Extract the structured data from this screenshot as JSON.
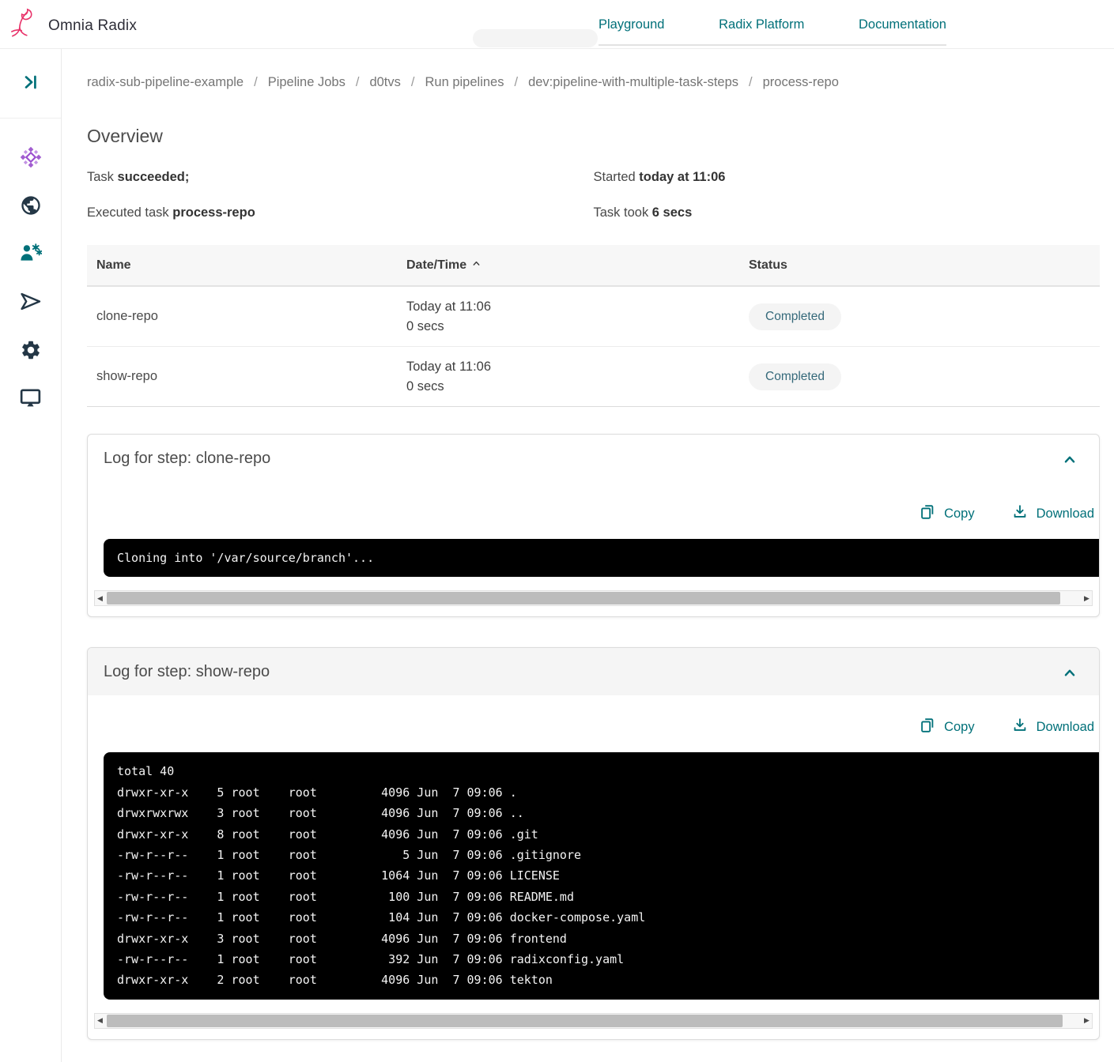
{
  "header": {
    "brand": "Omnia Radix",
    "nav": [
      {
        "label": "Playground"
      },
      {
        "label": "Radix Platform"
      },
      {
        "label": "Documentation"
      }
    ]
  },
  "sidebar": {
    "icons": [
      {
        "name": "app-mosaic-icon"
      },
      {
        "name": "globe-icon"
      },
      {
        "name": "user-settings-icon"
      },
      {
        "name": "send-icon"
      },
      {
        "name": "gear-icon"
      },
      {
        "name": "monitor-icon"
      }
    ]
  },
  "breadcrumb": {
    "separator": "/",
    "items": [
      "radix-sub-pipeline-example",
      "Pipeline Jobs",
      "d0tvs",
      "Run pipelines",
      "dev:pipeline-with-multiple-task-steps",
      "process-repo"
    ]
  },
  "overview": {
    "title": "Overview",
    "task_label": "Task",
    "task_status": "succeeded;",
    "executed_label": "Executed task",
    "executed_value": "process-repo",
    "started_label": "Started",
    "started_value": "today at 11:06",
    "duration_label": "Task took",
    "duration_value": "6 secs"
  },
  "steps_table": {
    "headers": {
      "name": "Name",
      "datetime": "Date/Time",
      "status": "Status"
    },
    "rows": [
      {
        "name": "clone-repo",
        "date": "Today at 11:06",
        "duration": "0 secs",
        "status": "Completed"
      },
      {
        "name": "show-repo",
        "date": "Today at 11:06",
        "duration": "0 secs",
        "status": "Completed"
      }
    ]
  },
  "logs": [
    {
      "title": "Log for step: clone-repo",
      "copy_label": "Copy",
      "download_label": "Download",
      "terminal_lines": [
        "Cloning into '/var/source/branch'..."
      ]
    },
    {
      "title": "Log for step: show-repo",
      "copy_label": "Copy",
      "download_label": "Download",
      "terminal_lines": [
        "total 40",
        "drwxr-xr-x    5 root    root         4096 Jun  7 09:06 .",
        "drwxrwxrwx    3 root    root         4096 Jun  7 09:06 ..",
        "drwxr-xr-x    8 root    root         4096 Jun  7 09:06 .git",
        "-rw-r--r--    1 root    root            5 Jun  7 09:06 .gitignore",
        "-rw-r--r--    1 root    root         1064 Jun  7 09:06 LICENSE",
        "-rw-r--r--    1 root    root          100 Jun  7 09:06 README.md",
        "-rw-r--r--    1 root    root          104 Jun  7 09:06 docker-compose.yaml",
        "drwxr-xr-x    3 root    root         4096 Jun  7 09:06 frontend",
        "-rw-r--r--    1 root    root          392 Jun  7 09:06 radixconfig.yaml",
        "drwxr-xr-x    2 root    root         4096 Jun  7 09:06 tekton"
      ]
    }
  ],
  "colors": {
    "accent_teal": "#007079",
    "brand_pink": "#e8336a",
    "icon_navy": "#243746",
    "icon_purple": "#a25ed0",
    "badge_bg": "#f4f4f4",
    "badge_text": "#35697a",
    "terminal_bg": "#000000",
    "terminal_text": "#f4f4f4"
  }
}
